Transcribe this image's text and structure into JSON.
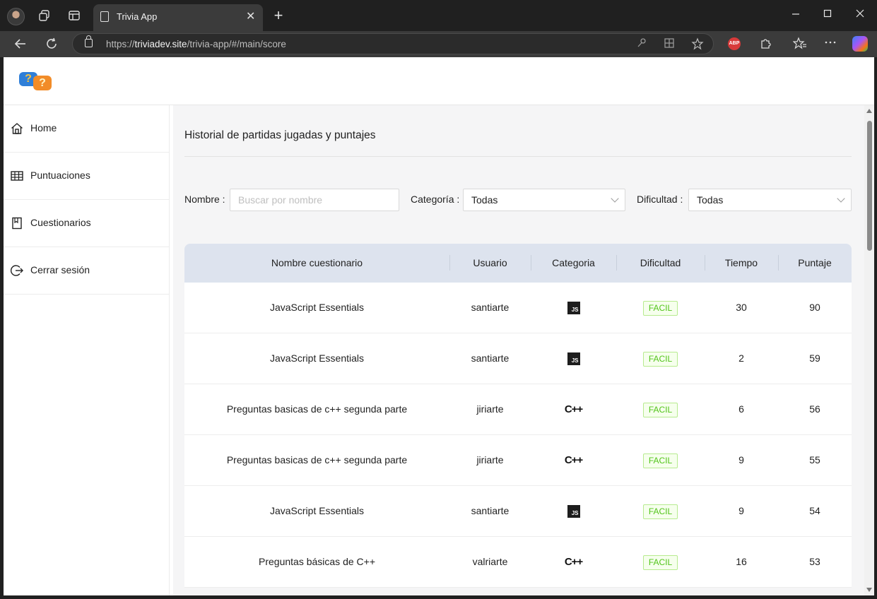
{
  "browser": {
    "tab_title": "Trivia App",
    "url_prefix": "https://",
    "url_host": "triviadev.site",
    "url_path": "/trivia-app/#/main/score",
    "new_tab_symbol": "+",
    "tab_close_symbol": "✕",
    "adblock_label": "ABP",
    "icons": [
      "profile-avatar",
      "workspaces-icon",
      "tab-actions-icon",
      "back-icon",
      "refresh-icon",
      "lock-icon",
      "key-icon",
      "apps-icon",
      "favorite-star-icon",
      "extensions-icon",
      "favorites-icon",
      "more-icon",
      "copilot-icon",
      "minimize-icon",
      "maximize-icon",
      "close-icon"
    ]
  },
  "sidebar": {
    "items": [
      {
        "label": "Home",
        "icon": "home-icon"
      },
      {
        "label": "Puntuaciones",
        "icon": "table-icon"
      },
      {
        "label": "Cuestionarios",
        "icon": "book-icon"
      },
      {
        "label": "Cerrar sesión",
        "icon": "logout-icon"
      }
    ]
  },
  "logo": {
    "q1": "?",
    "q2": "?"
  },
  "main": {
    "title": "Historial de partidas jugadas y puntajes",
    "filters": {
      "name_label": "Nombre",
      "name_placeholder": "Buscar por nombre",
      "category_label": "Categoría",
      "category_value": "Todas",
      "difficulty_label": "Dificultad",
      "difficulty_value": "Todas"
    },
    "table": {
      "columns": [
        "Nombre cuestionario",
        "Usuario",
        "Categoria",
        "Dificultad",
        "Tiempo",
        "Puntaje"
      ],
      "rows": [
        {
          "name": "JavaScript Essentials",
          "user": "santiarte",
          "category": "js",
          "difficulty": "FACIL",
          "time": "30",
          "score": "90"
        },
        {
          "name": "JavaScript Essentials",
          "user": "santiarte",
          "category": "js",
          "difficulty": "FACIL",
          "time": "2",
          "score": "59"
        },
        {
          "name": "Preguntas basicas de c++ segunda parte",
          "user": "jiriarte",
          "category": "cpp",
          "difficulty": "FACIL",
          "time": "6",
          "score": "56"
        },
        {
          "name": "Preguntas basicas de c++ segunda parte",
          "user": "jiriarte",
          "category": "cpp",
          "difficulty": "FACIL",
          "time": "9",
          "score": "55"
        },
        {
          "name": "JavaScript Essentials",
          "user": "santiarte",
          "category": "js",
          "difficulty": "FACIL",
          "time": "9",
          "score": "54"
        },
        {
          "name": "Preguntas básicas de C++",
          "user": "valriarte",
          "category": "cpp",
          "difficulty": "FACIL",
          "time": "16",
          "score": "53"
        }
      ],
      "category_icons": {
        "js": "JS",
        "cpp": "C++"
      }
    }
  },
  "colors": {
    "header_bg": "#dde3ee",
    "badge_green": "#52c41a",
    "content_bg": "#f5f5f6"
  }
}
